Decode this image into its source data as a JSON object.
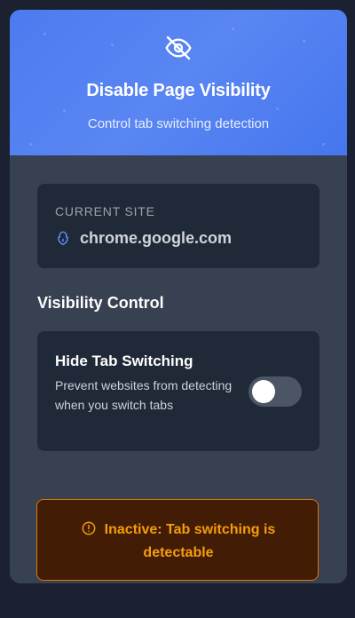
{
  "header": {
    "icon": "eye-off-icon",
    "title": "Disable Page Visibility",
    "subtitle": "Control tab switching detection"
  },
  "current_site": {
    "label": "CURRENT SITE",
    "icon": "lock-icon",
    "domain": "chrome.google.com"
  },
  "visibility_control": {
    "section_title": "Visibility Control",
    "option_title": "Hide Tab Switching",
    "option_description": "Prevent websites from detecting when you switch tabs",
    "toggle_on": false
  },
  "status": {
    "icon": "alert-circle-icon",
    "text": "Inactive: Tab switching is detectable"
  },
  "colors": {
    "accent": "#4d7bf0",
    "panel": "#374151",
    "card": "#1f2937",
    "warning_text": "#f59e0b",
    "warning_border": "#d97706",
    "warning_bg": "#431c05"
  }
}
